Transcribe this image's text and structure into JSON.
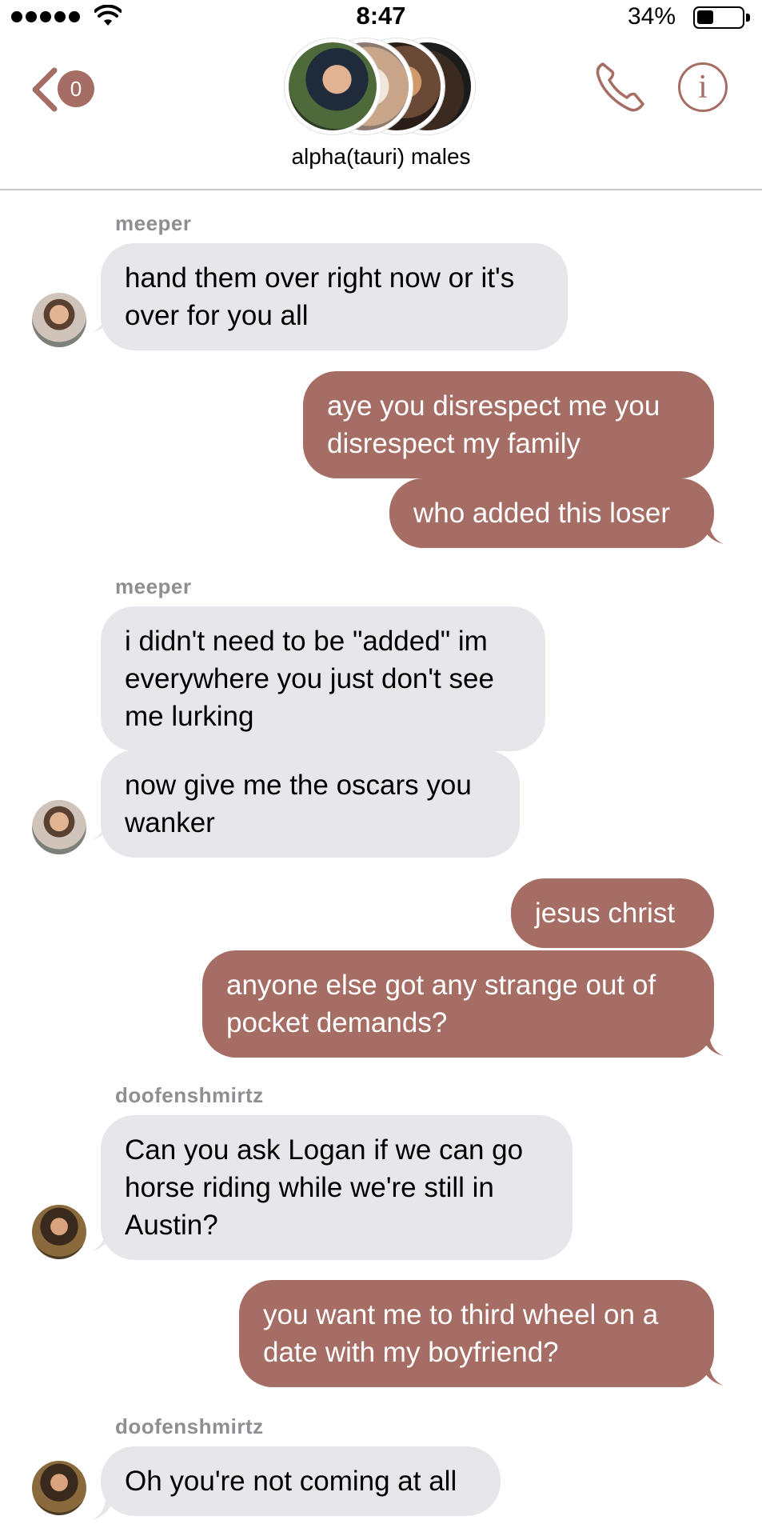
{
  "status": {
    "time": "8:47",
    "battery": "34%"
  },
  "header": {
    "back_count": "0",
    "group_name": "alpha(tauri) males",
    "info_glyph": "i",
    "accent": "#a66d64"
  },
  "messages": {
    "s1": "meeper",
    "m1": "hand them over right now or it's over for you all",
    "m2": "aye you disrespect me you disrespect my family",
    "m3": "who added this loser",
    "s2": "meeper",
    "m4": "i didn't need to be \"added\" im everywhere you just don't see me lurking",
    "m5": "now give me the oscars you wanker",
    "m6": "jesus christ",
    "m7": "anyone else got any strange out of pocket demands?",
    "s3": "doofenshmirtz",
    "m8": "Can you ask Logan if we can go horse riding while we're still in Austin?",
    "m9": "you want me to third wheel on a date with my boyfriend?",
    "s4": "doofenshmirtz",
    "m10": "Oh you're not coming at all"
  },
  "colors": {
    "incoming_bubble": "#e6e6eb",
    "outgoing_bubble": "#a66d64",
    "sender_label": "#8e8e93"
  }
}
